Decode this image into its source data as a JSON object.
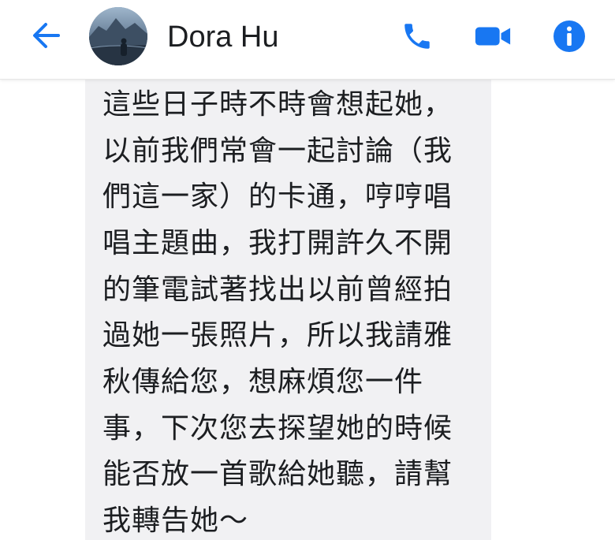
{
  "header": {
    "contact_name": "Dora Hu",
    "accent_color": "#1877f2"
  },
  "icons": {
    "back": "back-arrow-icon",
    "call": "phone-icon",
    "video": "video-camera-icon",
    "info": "info-icon"
  },
  "message": {
    "lines": [
      "這些日子時不時會想起她，",
      "以前我們常會一起討論（我",
      "們這一家）的卡通，哼哼唱",
      "唱主題曲，我打開許久不開",
      "的筆電試著找出以前曾經拍",
      "過她一張照片，所以我請雅",
      "秋傳給您，想麻煩您一件",
      "事，下次您去探望她的時候",
      "能否放一首歌給她聽，請幫",
      "我轉告她～"
    ]
  }
}
